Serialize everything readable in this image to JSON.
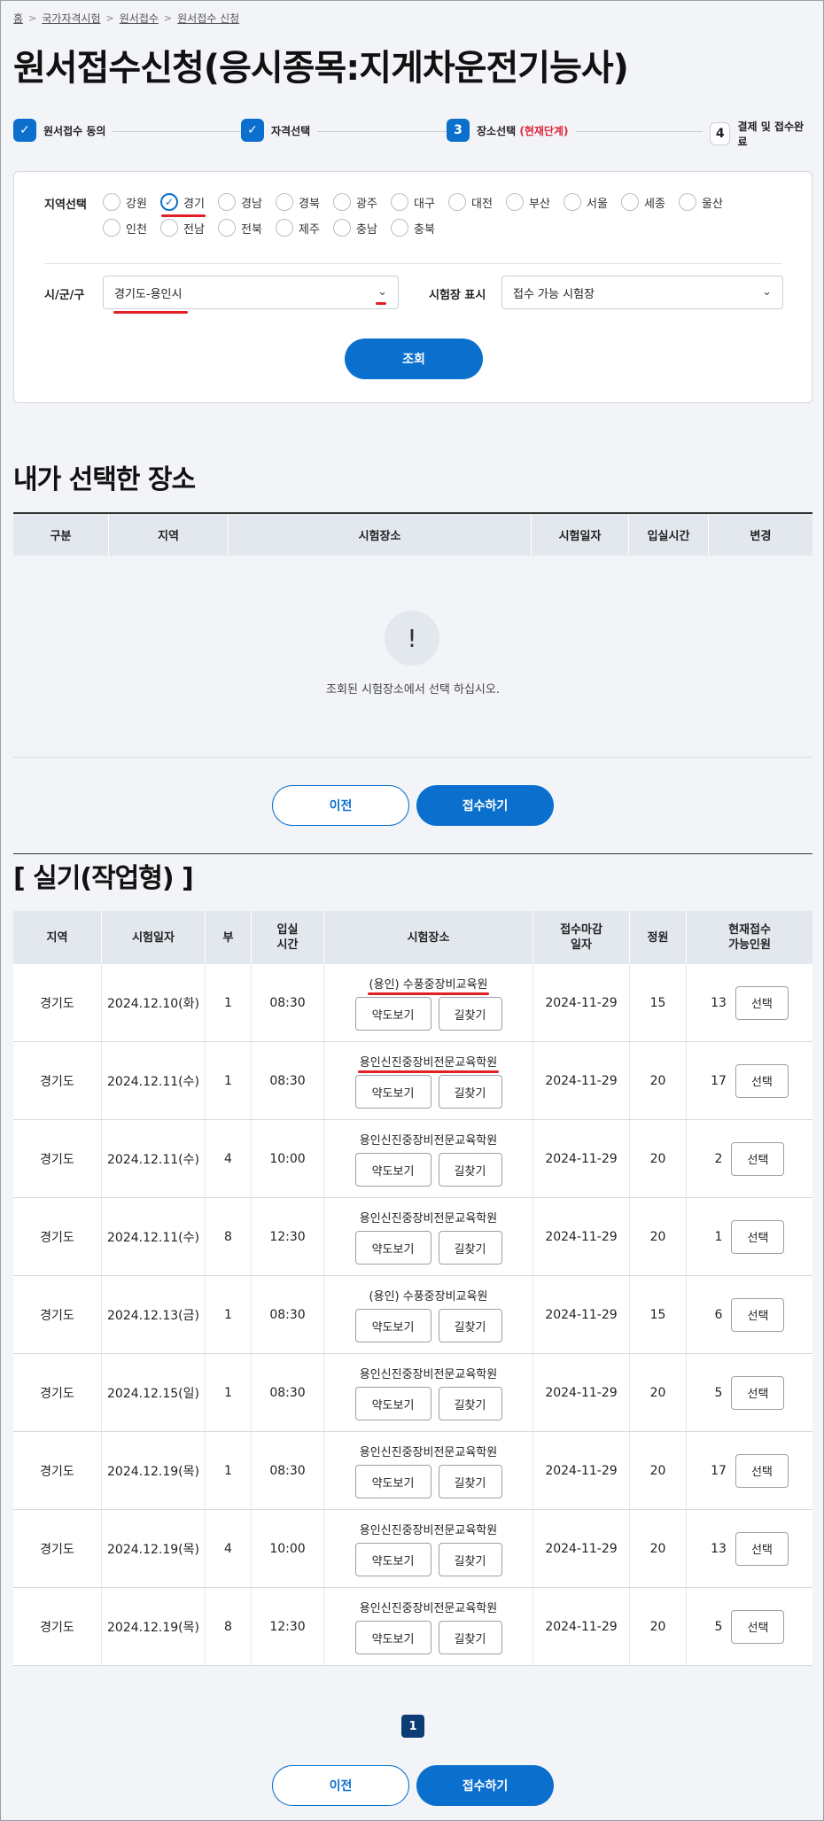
{
  "breadcrumb": [
    "홈",
    "국가자격시험",
    "원서접수",
    "원서접수 신청"
  ],
  "page_title": "원서접수신청(응시종목:지게차운전기능사)",
  "steps": [
    {
      "num": "✓",
      "label": "원서접수 동의"
    },
    {
      "num": "✓",
      "label": "자격선택"
    },
    {
      "num": "3",
      "label": "장소선택",
      "current": "(현재단계)"
    },
    {
      "num": "4",
      "label": "결제 및 접수완료"
    }
  ],
  "filter": {
    "region_label": "지역선택",
    "regions": [
      "강원",
      "경기",
      "경남",
      "경북",
      "광주",
      "대구",
      "대전",
      "부산",
      "서울",
      "세종",
      "울산",
      "인천",
      "전남",
      "전북",
      "제주",
      "충남",
      "충북"
    ],
    "selected_region": "경기",
    "city_label": "시/군/구",
    "city_value": "경기도-용인시",
    "venue_label": "시험장 표시",
    "venue_value": "접수 가능 시험장",
    "search_button": "조회"
  },
  "selected_section": {
    "title": "내가 선택한 장소",
    "columns": [
      "구분",
      "지역",
      "시험장소",
      "시험일자",
      "입실시간",
      "변경"
    ],
    "empty_icon": "!",
    "empty_message": "조회된 시험장소에서 선택 하십시오."
  },
  "actions": {
    "prev": "이전",
    "submit": "접수하기"
  },
  "practical": {
    "title": "[ 실기(작업형) ]",
    "columns": [
      "지역",
      "시험일자",
      "부",
      "입실\n시간",
      "시험장소",
      "접수마감\n일자",
      "정원",
      "현재접수\n가능인원"
    ],
    "map_button": "약도보기",
    "route_button": "길찾기",
    "select_button": "선택",
    "rows": [
      {
        "region": "경기도",
        "date": "2024.12.10(화)",
        "part": "1",
        "time": "08:30",
        "venue": "(용인) 수풍중장비교육원",
        "deadline": "2024-11-29",
        "capacity": "15",
        "available": "13"
      },
      {
        "region": "경기도",
        "date": "2024.12.11(수)",
        "part": "1",
        "time": "08:30",
        "venue": "용인신진중장비전문교육학원",
        "deadline": "2024-11-29",
        "capacity": "20",
        "available": "17"
      },
      {
        "region": "경기도",
        "date": "2024.12.11(수)",
        "part": "4",
        "time": "10:00",
        "venue": "용인신진중장비전문교육학원",
        "deadline": "2024-11-29",
        "capacity": "20",
        "available": "2"
      },
      {
        "region": "경기도",
        "date": "2024.12.11(수)",
        "part": "8",
        "time": "12:30",
        "venue": "용인신진중장비전문교육학원",
        "deadline": "2024-11-29",
        "capacity": "20",
        "available": "1"
      },
      {
        "region": "경기도",
        "date": "2024.12.13(금)",
        "part": "1",
        "time": "08:30",
        "venue": "(용인) 수풍중장비교육원",
        "deadline": "2024-11-29",
        "capacity": "15",
        "available": "6"
      },
      {
        "region": "경기도",
        "date": "2024.12.15(일)",
        "part": "1",
        "time": "08:30",
        "venue": "용인신진중장비전문교육학원",
        "deadline": "2024-11-29",
        "capacity": "20",
        "available": "5"
      },
      {
        "region": "경기도",
        "date": "2024.12.19(목)",
        "part": "1",
        "time": "08:30",
        "venue": "용인신진중장비전문교육학원",
        "deadline": "2024-11-29",
        "capacity": "20",
        "available": "17"
      },
      {
        "region": "경기도",
        "date": "2024.12.19(목)",
        "part": "4",
        "time": "10:00",
        "venue": "용인신진중장비전문교육학원",
        "deadline": "2024-11-29",
        "capacity": "20",
        "available": "13"
      },
      {
        "region": "경기도",
        "date": "2024.12.19(목)",
        "part": "8",
        "time": "12:30",
        "venue": "용인신진중장비전문교육학원",
        "deadline": "2024-11-29",
        "capacity": "20",
        "available": "5"
      }
    ]
  },
  "pagination": {
    "current": "1"
  },
  "colors": {
    "primary": "#0b6fce",
    "accent_red": "#e01f26",
    "current_step": "#e0263b",
    "pager": "#0d3b73"
  }
}
